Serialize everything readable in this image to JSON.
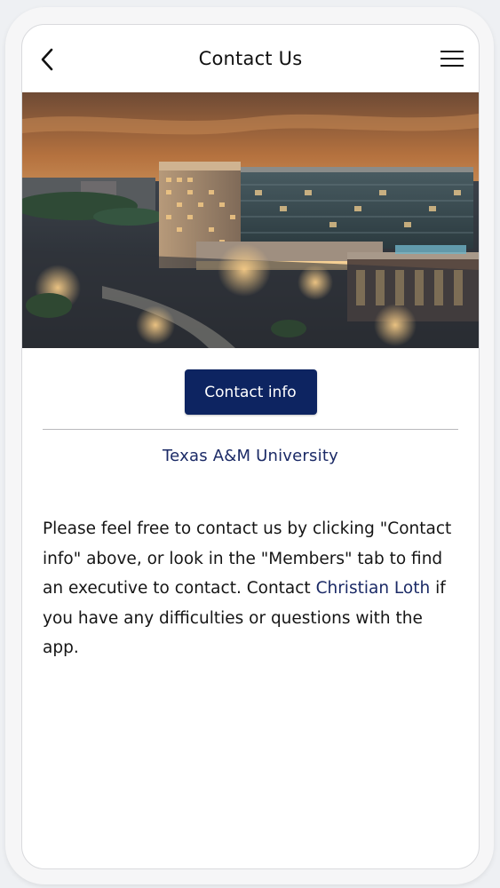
{
  "header": {
    "title": "Contact Us"
  },
  "hero": {
    "image_description": "Aerial dusk view of a large lit hotel and conference complex"
  },
  "actions": {
    "contact_button_label": "Contact info"
  },
  "organization": {
    "name": "Texas A&M University"
  },
  "message": {
    "part1": "Please feel free to contact us by clicking \"Contact info\" above, or look in the \"Members\" tab to find an executive to contact. Contact ",
    "link_text": "Christian Loth",
    "part2": " if you have any difficulties or questions with the app."
  },
  "colors": {
    "primary": "#0d2461",
    "link": "#1b2a66",
    "background": "#ffffff"
  },
  "icons": {
    "back": "chevron-left-icon",
    "menu": "hamburger-menu-icon"
  }
}
